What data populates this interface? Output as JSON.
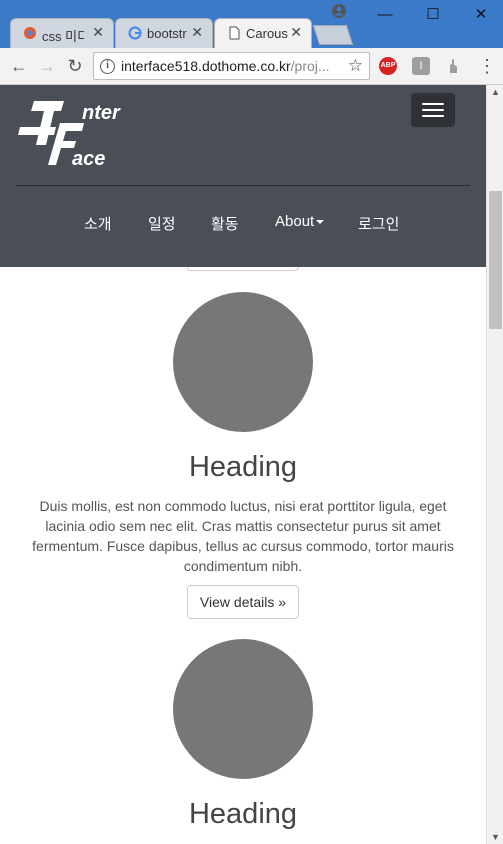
{
  "browser": {
    "tabs": [
      {
        "title": "css 미디",
        "icon": "chrome-extension-icon"
      },
      {
        "title": "bootstr",
        "icon": "google-g-icon"
      },
      {
        "title": "Carous",
        "icon": "page-icon",
        "active": true
      }
    ],
    "close_glyph": "✕",
    "window_controls": {
      "minimize": "—",
      "maximize": "☐",
      "close": "✕"
    },
    "address": {
      "host": "interface518.dothome.co.kr",
      "path": "/proj..."
    },
    "extensions": {
      "abp": "ABP",
      "ext2": "I"
    }
  },
  "navbar": {
    "logo_top": "nter",
    "logo_bottom": "ace",
    "links": [
      {
        "label": "소개"
      },
      {
        "label": "일정"
      },
      {
        "label": "활동"
      },
      {
        "label": "About"
      },
      {
        "label": "로그인"
      }
    ]
  },
  "features": [
    {
      "heading": "Heading",
      "text": "Duis mollis, est non commodo luctus, nisi erat porttitor ligula, eget lacinia odio sem nec elit. Cras mattis consectetur purus sit amet fermentum. Fusce dapibus, tellus ac cursus commodo, tortor mauris condimentum nibh.",
      "button": "View details »"
    },
    {
      "heading": "Heading"
    }
  ],
  "colors": {
    "navbar_bg": "#4a4f57",
    "circle": "#777777",
    "chrome_blue": "#3a7ac8"
  }
}
